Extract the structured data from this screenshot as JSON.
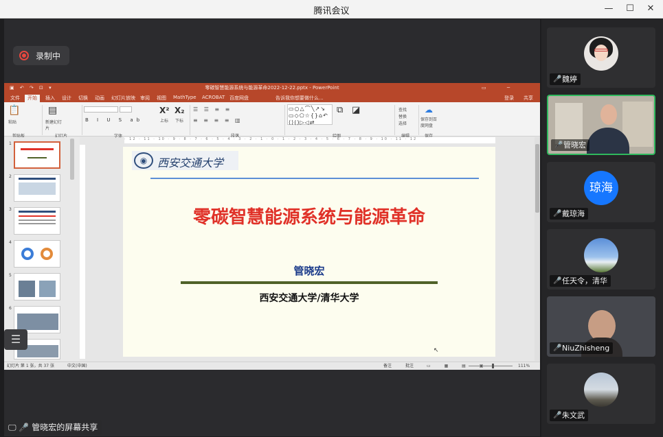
{
  "window": {
    "title": "腾讯会议"
  },
  "recording": {
    "label": "录制中"
  },
  "powerpoint": {
    "title": "零碳智慧能源系统与能源革命2022-12-22.pptx - PowerPoint",
    "login": "登录",
    "share": "共享",
    "tabs": [
      "文件",
      "开始",
      "插入",
      "设计",
      "切换",
      "动画",
      "幻灯片放映",
      "审阅",
      "视图",
      "MathType",
      "ACROBAT",
      "百度网盘",
      "告诉我你想要做什么..."
    ],
    "ribbon_groups": [
      "剪贴板",
      "幻灯片",
      "字体",
      "段落",
      "绘图",
      "编辑",
      "保存"
    ],
    "ribbon_buttons": {
      "paste": "粘贴",
      "new_slide": "新建幻灯片",
      "superscript": "上标",
      "subscript": "下标",
      "find": "查找",
      "replace": "替换",
      "select": "选择",
      "save_to_cloud": "保存到百度网盘"
    },
    "status": {
      "slide_info": "幻灯片 第 1 张，共 37 张",
      "language": "中文(中国)",
      "notes": "备注",
      "comments": "批注",
      "zoom": "111%"
    },
    "thumbnail_numbers": [
      "1",
      "2",
      "3",
      "4",
      "5",
      "6"
    ]
  },
  "slide": {
    "logo_text": "西安交通大学",
    "title": "零碳智慧能源系统与能源革命",
    "author": "管晓宏",
    "affiliation": "西安交通大学/清华大学"
  },
  "screen_share": {
    "label": "管晓宏的屏幕共享"
  },
  "participants": [
    {
      "name": "魏婷",
      "muted": true
    },
    {
      "name": "管晓宏",
      "muted": false,
      "active": true
    },
    {
      "name": "戴琼海",
      "muted": true,
      "avatar_text": "琼海"
    },
    {
      "name": "任天令，清华",
      "muted": true
    },
    {
      "name": "NiuZhisheng",
      "muted": true
    },
    {
      "name": "朱文武",
      "muted": true
    }
  ],
  "colors": {
    "accent_green": "#2fb95d",
    "ppt_red": "#b7472a",
    "mute_red": "#e8473f"
  }
}
